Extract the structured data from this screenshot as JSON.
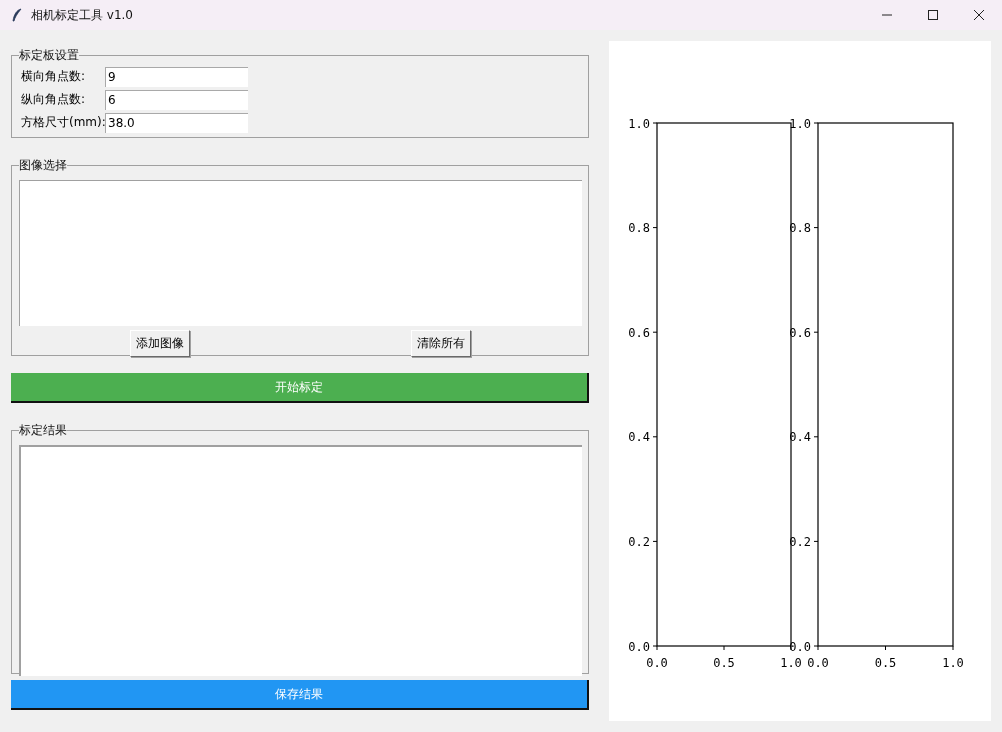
{
  "window": {
    "title": "相机标定工具 v1.0"
  },
  "board_settings": {
    "title": "标定板设置",
    "fields": [
      {
        "label": "横向角点数:",
        "value": "9"
      },
      {
        "label": "纵向角点数:",
        "value": "6"
      },
      {
        "label": "方格尺寸(mm):",
        "value": "38.0"
      }
    ]
  },
  "image_selection": {
    "title": "图像选择",
    "buttons": [
      "添加图像",
      "清除所有"
    ]
  },
  "start_button": "开始标定",
  "results": {
    "title": "标定结果"
  },
  "save_button": "保存结果",
  "plots": [
    {
      "chart_data": {
        "type": "line",
        "xlim": [
          0,
          1
        ],
        "ylim": [
          0,
          1
        ],
        "xticks": [
          {
            "value": 0,
            "label": "0.0"
          },
          {
            "value": 0.5,
            "label": "0.5"
          },
          {
            "value": 1,
            "label": "1.0"
          }
        ],
        "yticks": [
          {
            "value": 0,
            "label": "0.0"
          },
          {
            "value": 0.2,
            "label": "0.2"
          },
          {
            "value": 0.4,
            "label": "0.4"
          },
          {
            "value": 0.6,
            "label": "0.6"
          },
          {
            "value": 0.8,
            "label": "0.8"
          },
          {
            "value": 1,
            "label": "1.0"
          }
        ]
      }
    },
    {
      "chart_data": {
        "type": "line",
        "xlim": [
          0,
          1
        ],
        "ylim": [
          0,
          1
        ],
        "xticks": [
          {
            "value": 0,
            "label": "0.0"
          },
          {
            "value": 0.5,
            "label": "0.5"
          },
          {
            "value": 1,
            "label": "1.0"
          }
        ],
        "yticks": [
          {
            "value": 0,
            "label": "0.0"
          },
          {
            "value": 0.2,
            "label": "0.2"
          },
          {
            "value": 0.4,
            "label": "0.4"
          },
          {
            "value": 0.6,
            "label": "0.6"
          },
          {
            "value": 0.8,
            "label": "0.8"
          },
          {
            "value": 1,
            "label": "1.0"
          }
        ]
      }
    }
  ]
}
